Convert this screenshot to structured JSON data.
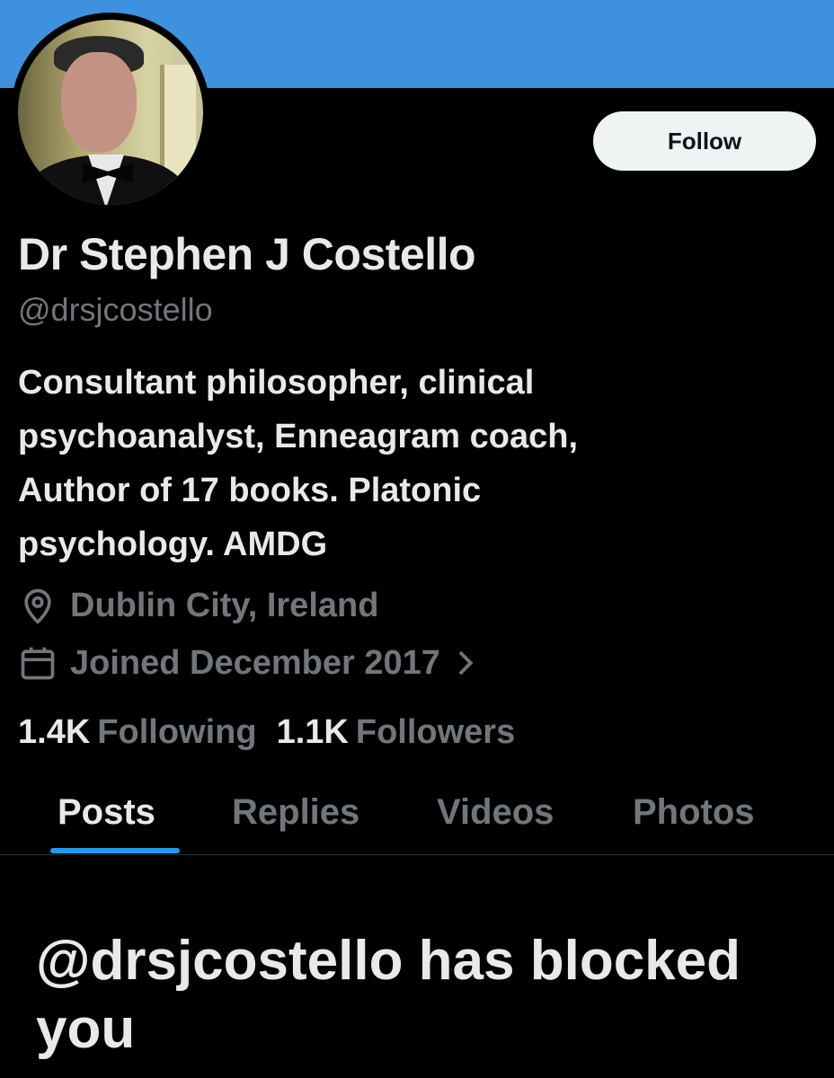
{
  "profile": {
    "display_name": "Dr Stephen J Costello",
    "handle": "@drsjcostello",
    "bio_lines": [
      "Consultant philosopher, clinical",
      "psychoanalyst, Enneagram coach,",
      "Author of 17 books. Platonic",
      "psychology. AMDG"
    ],
    "location": "Dublin City, Ireland",
    "joined": "Joined December 2017",
    "following_count": "1.4K",
    "following_label": "Following",
    "followers_count": "1.1K",
    "followers_label": "Followers"
  },
  "actions": {
    "follow_label": "Follow"
  },
  "tabs": [
    {
      "label": "Posts",
      "active": true
    },
    {
      "label": "Replies",
      "active": false
    },
    {
      "label": "Videos",
      "active": false
    },
    {
      "label": "Photos",
      "active": false
    }
  ],
  "blocked_message": "@drsjcostello has blocked you",
  "colors": {
    "banner": "#3e91df",
    "background": "#000000",
    "primary_text": "#e7e9ea",
    "secondary_text": "#71767b",
    "accent": "#1d9bf0",
    "button_bg": "#eff3f4"
  },
  "icons": {
    "location": "location-pin-icon",
    "calendar": "calendar-icon",
    "chevron": "chevron-right-icon"
  }
}
